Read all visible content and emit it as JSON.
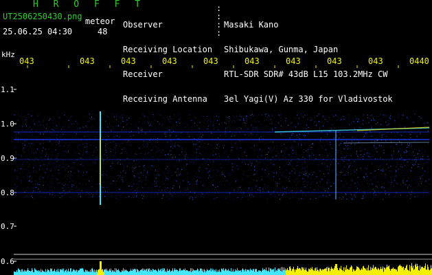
{
  "title": "H R O F F T",
  "file_name": "UT2506250430.png",
  "stamp": "25.06.25 04:30",
  "meteor_label": "meteor",
  "meteor_count": "48",
  "header": {
    "labels": [
      "Observer",
      "Receiving Location",
      "Receiver",
      "Receiving Antenna"
    ],
    "values": [
      "Masaki Kano",
      "Shibukawa, Gunma, Japan",
      "RTL-SDR SDR# 43dB L15 103.2MHz CW",
      "3el Yagi(V) Az 330 for Vladivostok"
    ]
  },
  "y_unit": "kHz",
  "y_ticks": [
    "1.1",
    "1.0",
    "0.9",
    "0.8",
    "0.7",
    "0.6"
  ],
  "x_ticks": [
    "043",
    "043",
    "043",
    "043",
    "043",
    "043",
    "043",
    "043",
    "043",
    "0440"
  ],
  "colors": {
    "text_white": "#ffffff",
    "text_yellow": "#f2f200",
    "title_green": "#2bd12b",
    "trace_blue": "#1f3cff",
    "signal_cyan": "#43e8ff",
    "signal_yellow": "#ffe400",
    "noise_yellow": "#f5f000"
  }
}
